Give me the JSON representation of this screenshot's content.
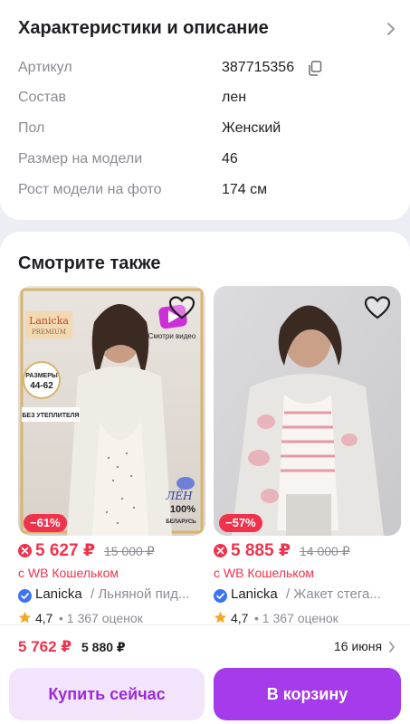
{
  "specs": {
    "title": "Характеристики и описание",
    "rows": [
      {
        "label": "Артикул",
        "value": "387715356"
      },
      {
        "label": "Состав",
        "value": "лен"
      },
      {
        "label": "Пол",
        "value": "Женский"
      },
      {
        "label": "Размер на модели",
        "value": "46"
      },
      {
        "label": "Рост модели на фото",
        "value": "174 см"
      }
    ]
  },
  "similar": {
    "title": "Смотрите также",
    "products": [
      {
        "discount": "−61%",
        "price": "5 627 ₽",
        "old_price": "15 000 ₽",
        "wallet": "с WB Кошельком",
        "brand": "Lanicka",
        "name": "/ Льняной пид...",
        "rating": "4,7",
        "reviews": "• 1 367 оценок",
        "img_labels": {
          "brand": "Lanicka",
          "premium": "PREMIUM",
          "sizes_title": "РАЗМЕРЫ",
          "sizes": "44-62",
          "no_insulation": "БЕЗ УТЕПЛИТЕЛЯ",
          "video": "Смотри видео",
          "linen_top": "ЛЁН",
          "linen_pct": "100%",
          "linen_country": "БЕЛАРУСЬ"
        }
      },
      {
        "discount": "−57%",
        "price": "5 885 ₽",
        "old_price": "14 000 ₽",
        "wallet": "с WB Кошельком",
        "brand": "Lanicka",
        "name": "/ Жакет стега...",
        "rating": "4,7",
        "reviews": "• 1 367 оценок"
      }
    ]
  },
  "bottom_bar": {
    "price": "5 762 ₽",
    "old_price": "5 880 ₽",
    "delivery_date": "16 июня",
    "buy_now": "Купить сейчас",
    "add_to_cart": "В корзину"
  },
  "colors": {
    "accent": "#a53bea",
    "price_red": "#f0334d",
    "verified_blue": "#3b73f4"
  }
}
